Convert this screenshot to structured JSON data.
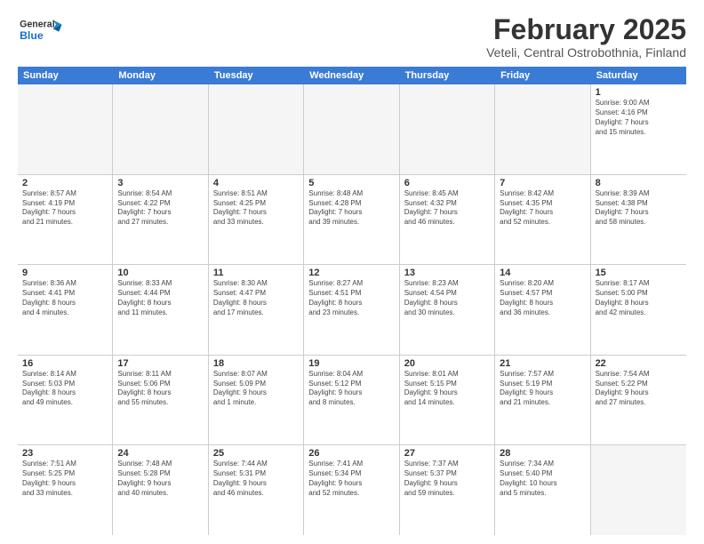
{
  "header": {
    "logo_general": "General",
    "logo_blue": "Blue",
    "month_title": "February 2025",
    "location": "Veteli, Central Ostrobothnia, Finland"
  },
  "weekdays": [
    "Sunday",
    "Monday",
    "Tuesday",
    "Wednesday",
    "Thursday",
    "Friday",
    "Saturday"
  ],
  "weeks": [
    [
      {
        "day": "",
        "info": "",
        "empty": true
      },
      {
        "day": "",
        "info": "",
        "empty": true
      },
      {
        "day": "",
        "info": "",
        "empty": true
      },
      {
        "day": "",
        "info": "",
        "empty": true
      },
      {
        "day": "",
        "info": "",
        "empty": true
      },
      {
        "day": "",
        "info": "",
        "empty": true
      },
      {
        "day": "1",
        "info": "Sunrise: 9:00 AM\nSunset: 4:16 PM\nDaylight: 7 hours\nand 15 minutes.",
        "empty": false
      }
    ],
    [
      {
        "day": "2",
        "info": "Sunrise: 8:57 AM\nSunset: 4:19 PM\nDaylight: 7 hours\nand 21 minutes.",
        "empty": false
      },
      {
        "day": "3",
        "info": "Sunrise: 8:54 AM\nSunset: 4:22 PM\nDaylight: 7 hours\nand 27 minutes.",
        "empty": false
      },
      {
        "day": "4",
        "info": "Sunrise: 8:51 AM\nSunset: 4:25 PM\nDaylight: 7 hours\nand 33 minutes.",
        "empty": false
      },
      {
        "day": "5",
        "info": "Sunrise: 8:48 AM\nSunset: 4:28 PM\nDaylight: 7 hours\nand 39 minutes.",
        "empty": false
      },
      {
        "day": "6",
        "info": "Sunrise: 8:45 AM\nSunset: 4:32 PM\nDaylight: 7 hours\nand 46 minutes.",
        "empty": false
      },
      {
        "day": "7",
        "info": "Sunrise: 8:42 AM\nSunset: 4:35 PM\nDaylight: 7 hours\nand 52 minutes.",
        "empty": false
      },
      {
        "day": "8",
        "info": "Sunrise: 8:39 AM\nSunset: 4:38 PM\nDaylight: 7 hours\nand 58 minutes.",
        "empty": false
      }
    ],
    [
      {
        "day": "9",
        "info": "Sunrise: 8:36 AM\nSunset: 4:41 PM\nDaylight: 8 hours\nand 4 minutes.",
        "empty": false
      },
      {
        "day": "10",
        "info": "Sunrise: 8:33 AM\nSunset: 4:44 PM\nDaylight: 8 hours\nand 11 minutes.",
        "empty": false
      },
      {
        "day": "11",
        "info": "Sunrise: 8:30 AM\nSunset: 4:47 PM\nDaylight: 8 hours\nand 17 minutes.",
        "empty": false
      },
      {
        "day": "12",
        "info": "Sunrise: 8:27 AM\nSunset: 4:51 PM\nDaylight: 8 hours\nand 23 minutes.",
        "empty": false
      },
      {
        "day": "13",
        "info": "Sunrise: 8:23 AM\nSunset: 4:54 PM\nDaylight: 8 hours\nand 30 minutes.",
        "empty": false
      },
      {
        "day": "14",
        "info": "Sunrise: 8:20 AM\nSunset: 4:57 PM\nDaylight: 8 hours\nand 36 minutes.",
        "empty": false
      },
      {
        "day": "15",
        "info": "Sunrise: 8:17 AM\nSunset: 5:00 PM\nDaylight: 8 hours\nand 42 minutes.",
        "empty": false
      }
    ],
    [
      {
        "day": "16",
        "info": "Sunrise: 8:14 AM\nSunset: 5:03 PM\nDaylight: 8 hours\nand 49 minutes.",
        "empty": false
      },
      {
        "day": "17",
        "info": "Sunrise: 8:11 AM\nSunset: 5:06 PM\nDaylight: 8 hours\nand 55 minutes.",
        "empty": false
      },
      {
        "day": "18",
        "info": "Sunrise: 8:07 AM\nSunset: 5:09 PM\nDaylight: 9 hours\nand 1 minute.",
        "empty": false
      },
      {
        "day": "19",
        "info": "Sunrise: 8:04 AM\nSunset: 5:12 PM\nDaylight: 9 hours\nand 8 minutes.",
        "empty": false
      },
      {
        "day": "20",
        "info": "Sunrise: 8:01 AM\nSunset: 5:15 PM\nDaylight: 9 hours\nand 14 minutes.",
        "empty": false
      },
      {
        "day": "21",
        "info": "Sunrise: 7:57 AM\nSunset: 5:19 PM\nDaylight: 9 hours\nand 21 minutes.",
        "empty": false
      },
      {
        "day": "22",
        "info": "Sunrise: 7:54 AM\nSunset: 5:22 PM\nDaylight: 9 hours\nand 27 minutes.",
        "empty": false
      }
    ],
    [
      {
        "day": "23",
        "info": "Sunrise: 7:51 AM\nSunset: 5:25 PM\nDaylight: 9 hours\nand 33 minutes.",
        "empty": false
      },
      {
        "day": "24",
        "info": "Sunrise: 7:48 AM\nSunset: 5:28 PM\nDaylight: 9 hours\nand 40 minutes.",
        "empty": false
      },
      {
        "day": "25",
        "info": "Sunrise: 7:44 AM\nSunset: 5:31 PM\nDaylight: 9 hours\nand 46 minutes.",
        "empty": false
      },
      {
        "day": "26",
        "info": "Sunrise: 7:41 AM\nSunset: 5:34 PM\nDaylight: 9 hours\nand 52 minutes.",
        "empty": false
      },
      {
        "day": "27",
        "info": "Sunrise: 7:37 AM\nSunset: 5:37 PM\nDaylight: 9 hours\nand 59 minutes.",
        "empty": false
      },
      {
        "day": "28",
        "info": "Sunrise: 7:34 AM\nSunset: 5:40 PM\nDaylight: 10 hours\nand 5 minutes.",
        "empty": false
      },
      {
        "day": "",
        "info": "",
        "empty": true
      }
    ]
  ]
}
